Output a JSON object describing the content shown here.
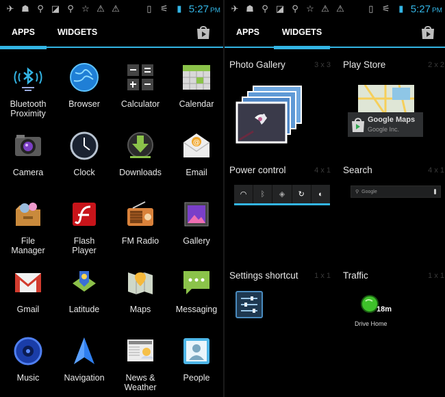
{
  "status": {
    "time": "5:27",
    "ampm": "PM"
  },
  "left": {
    "tabs": [
      {
        "label": "APPS",
        "active": true
      },
      {
        "label": "WIDGETS",
        "active": false
      }
    ],
    "apps": [
      {
        "label": "Bluetooth\nProximity"
      },
      {
        "label": "Browser"
      },
      {
        "label": "Calculator"
      },
      {
        "label": "Calendar"
      },
      {
        "label": "Camera"
      },
      {
        "label": "Clock"
      },
      {
        "label": "Downloads"
      },
      {
        "label": "Email"
      },
      {
        "label": "File\nManager"
      },
      {
        "label": "Flash\nPlayer"
      },
      {
        "label": "FM Radio"
      },
      {
        "label": "Gallery"
      },
      {
        "label": "Gmail"
      },
      {
        "label": "Latitude"
      },
      {
        "label": "Maps"
      },
      {
        "label": "Messaging"
      },
      {
        "label": "Music"
      },
      {
        "label": "Navigation"
      },
      {
        "label": "News &\nWeather"
      },
      {
        "label": "People"
      }
    ]
  },
  "right": {
    "tabs": [
      {
        "label": "APPS",
        "active": false
      },
      {
        "label": "WIDGETS",
        "active": true
      }
    ],
    "widgets": {
      "photo_gallery": {
        "title": "Photo Gallery",
        "size": "3 x 3"
      },
      "play_store": {
        "title": "Play Store",
        "size": "2 x 2",
        "card_title": "Google Maps",
        "card_sub": "Google Inc."
      },
      "power_control": {
        "title": "Power control",
        "size": "4 x 1"
      },
      "search": {
        "title": "Search",
        "size": "4 x 1",
        "placeholder": "Google"
      },
      "settings_shortcut": {
        "title": "Settings shortcut",
        "size": "1 x 1"
      },
      "traffic": {
        "title": "Traffic",
        "size": "1 x 1",
        "eta": "18m",
        "label": "Drive Home"
      }
    }
  }
}
